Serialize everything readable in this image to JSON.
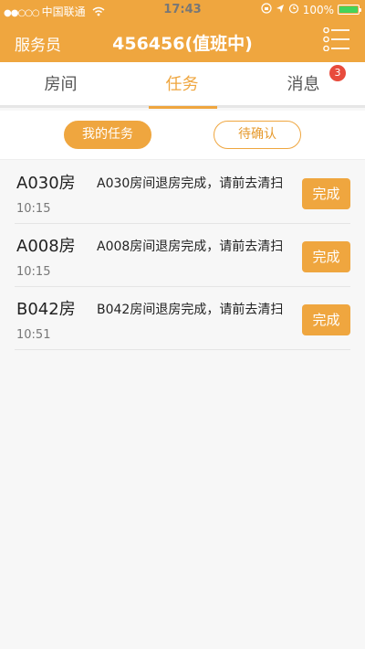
{
  "status_bar": {
    "carrier": "中国联通",
    "time": "17:43",
    "battery": "100%",
    "battery_level": 1.0
  },
  "header": {
    "left_label": "服务员",
    "title": "456456(值班中)",
    "menu_icon": "list-menu-icon",
    "color": "#efa63f"
  },
  "tabs": [
    {
      "label": "房间"
    },
    {
      "label": "任务"
    },
    {
      "label": "消息",
      "badge": "3"
    }
  ],
  "active_tab": "任务",
  "filters": {
    "mine": "我的任务",
    "pending": "待确认"
  },
  "tasks": [
    {
      "room": "A030房",
      "message": "A030房间退房完成，请前去清扫",
      "time": "10:15",
      "action": "完成"
    },
    {
      "room": "A008房",
      "message": "A008房间退房完成，请前去清扫",
      "time": "10:15",
      "action": "完成"
    },
    {
      "room": "B042房",
      "message": "B042房间退房完成，请前去清扫",
      "time": "10:51",
      "action": "完成"
    }
  ]
}
